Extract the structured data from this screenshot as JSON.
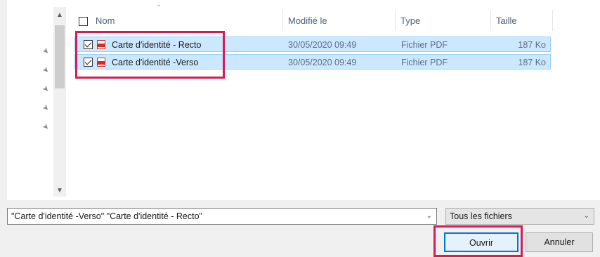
{
  "columns": {
    "name": "Nom",
    "modified": "Modifié le",
    "type": "Type",
    "size": "Taille"
  },
  "files": [
    {
      "name": "Carte d'identité - Recto",
      "modified": "30/05/2020 09:49",
      "type": "Fichier PDF",
      "size": "187 Ko",
      "checked": true
    },
    {
      "name": "Carte d'identité -Verso",
      "modified": "30/05/2020 09:49",
      "type": "Fichier PDF",
      "size": "187 Ko",
      "checked": true
    }
  ],
  "filename_field": {
    "value": "\"Carte d'identité -Verso\" \"Carte d'identité - Recto\""
  },
  "file_type_filter": {
    "selected": "Tous les fichiers"
  },
  "buttons": {
    "open": "Ouvrir",
    "cancel": "Annuler"
  },
  "colors": {
    "selection": "#cce8ff",
    "highlight": "#d81b52",
    "accent": "#0078d7"
  }
}
